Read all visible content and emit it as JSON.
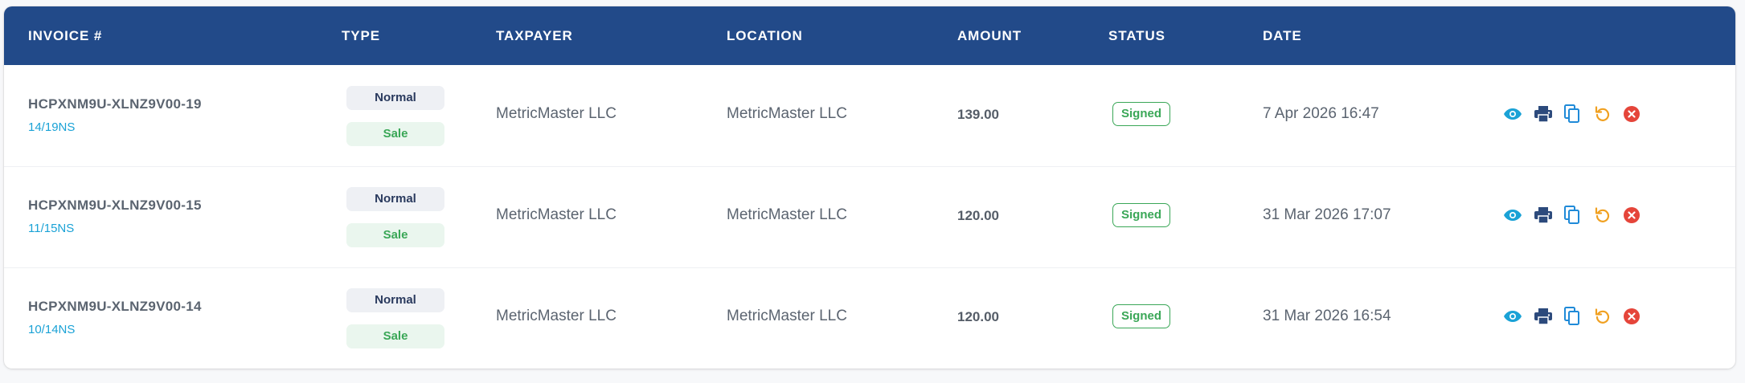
{
  "table": {
    "headers": {
      "invoice": "INVOICE #",
      "type": "TYPE",
      "taxpayer": "TAXPAYER",
      "location": "LOCATION",
      "amount": "AMOUNT",
      "status": "STATUS",
      "date": "DATE"
    },
    "rows": [
      {
        "invoice_number": "HCPXNM9U-XLNZ9V00-19",
        "invoice_sub": "14/19NS",
        "type_primary": "Normal",
        "type_secondary": "Sale",
        "taxpayer": "MetricMaster LLC",
        "location": "MetricMaster LLC",
        "amount": "139.00",
        "status": "Signed",
        "date": "7 Apr 2026 16:47"
      },
      {
        "invoice_number": "HCPXNM9U-XLNZ9V00-15",
        "invoice_sub": "11/15NS",
        "type_primary": "Normal",
        "type_secondary": "Sale",
        "taxpayer": "MetricMaster LLC",
        "location": "MetricMaster LLC",
        "amount": "120.00",
        "status": "Signed",
        "date": "31 Mar 2026 17:07"
      },
      {
        "invoice_number": "HCPXNM9U-XLNZ9V00-14",
        "invoice_sub": "10/14NS",
        "type_primary": "Normal",
        "type_secondary": "Sale",
        "taxpayer": "MetricMaster LLC",
        "location": "MetricMaster LLC",
        "amount": "120.00",
        "status": "Signed",
        "date": "31 Mar 2026 16:54"
      }
    ],
    "actions": [
      "eye-icon",
      "print-icon",
      "copy-icon",
      "undo-icon",
      "cancel-icon"
    ]
  },
  "colors": {
    "header_bg": "#224a89",
    "link": "#1aa2d6",
    "signed": "#3aa757",
    "print": "#2c4a7c",
    "copy": "#1f8ad8",
    "undo": "#f0a020",
    "cancel": "#e5453a"
  }
}
